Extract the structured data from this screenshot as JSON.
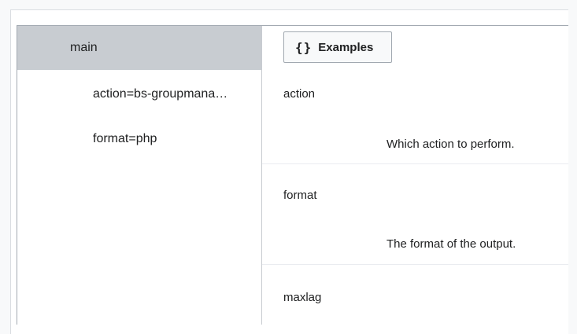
{
  "sidebar": {
    "items": [
      {
        "label": "main"
      },
      {
        "label": "action=bs-groupmana…"
      },
      {
        "label": "format=php"
      }
    ]
  },
  "toolbar": {
    "examples_icon": "{}",
    "examples_label": "Examples"
  },
  "params": [
    {
      "name": "action",
      "description": "Which action to perform."
    },
    {
      "name": "format",
      "description": "The format of the output."
    },
    {
      "name": "maxlag",
      "description": ""
    }
  ],
  "colors": {
    "selected_bg": "#c8ccd1",
    "border": "#a2a9b1",
    "divider": "#eaecf0"
  }
}
